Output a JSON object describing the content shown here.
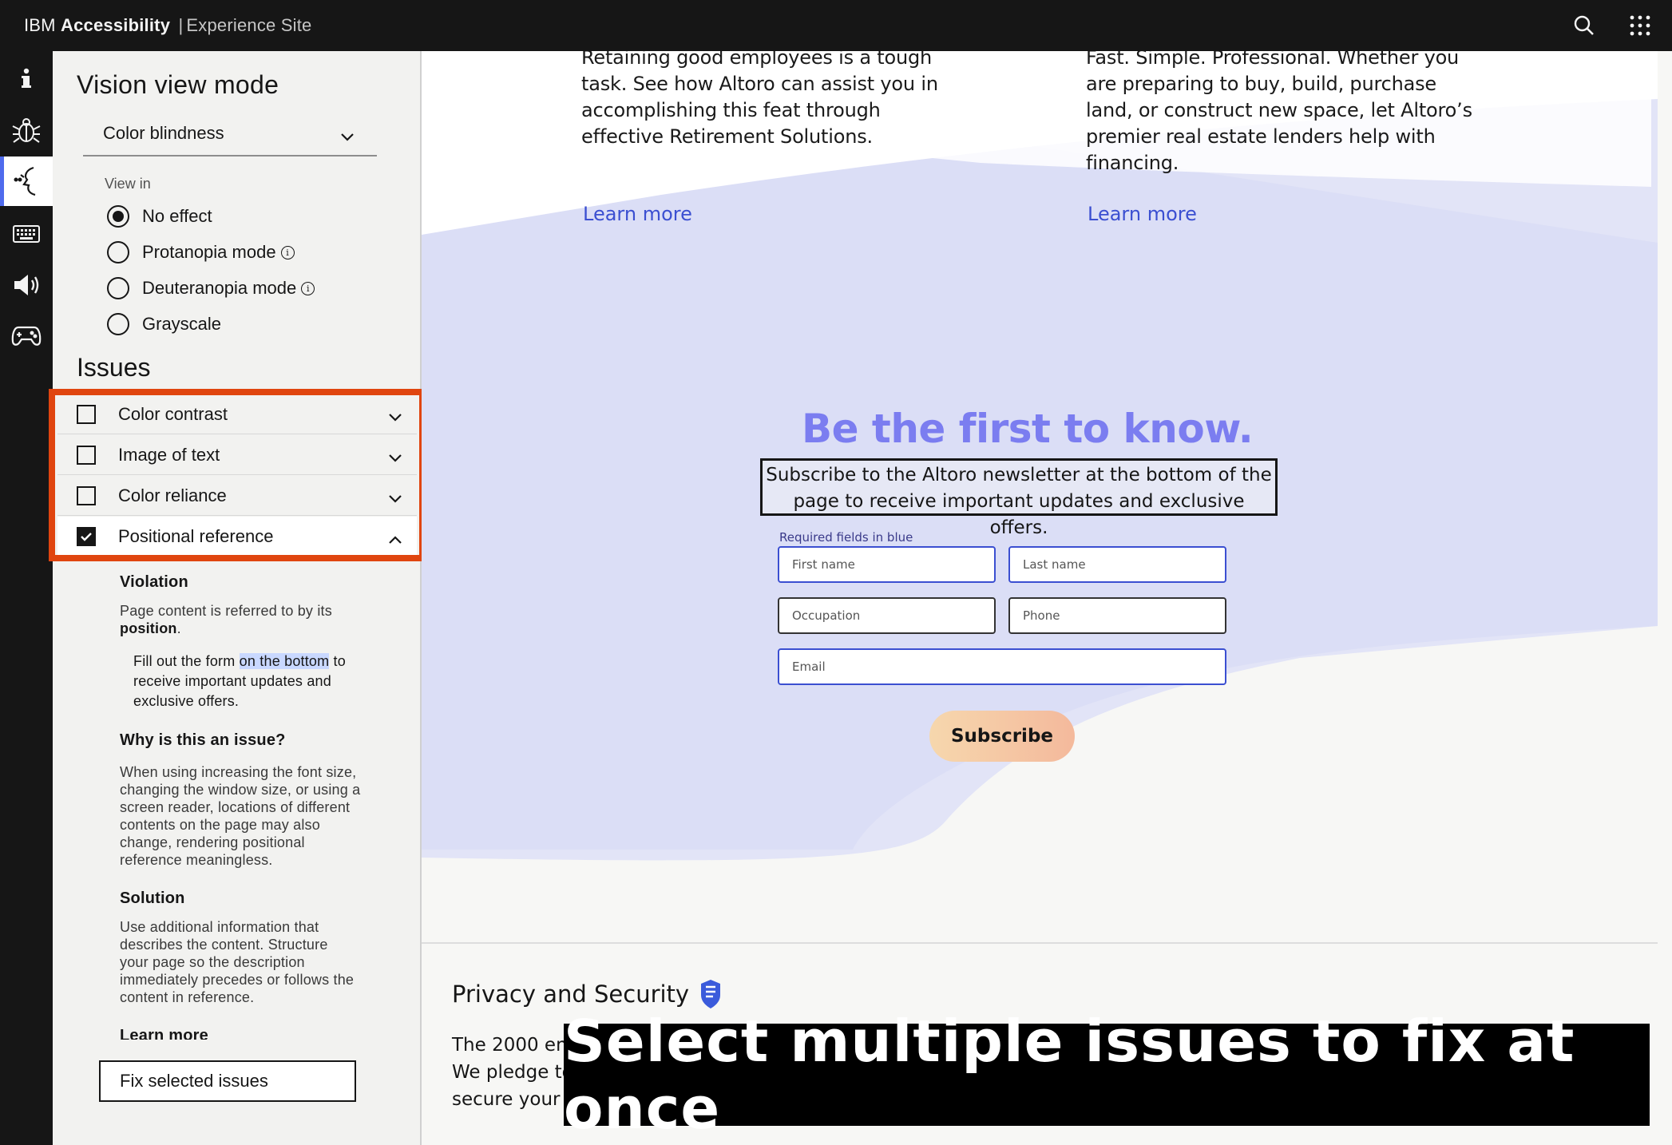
{
  "topbar": {
    "brand_ibm": "IBM",
    "brand_name": "Accessibility",
    "separator": "|",
    "brand_site": "Experience Site",
    "search_icon": "search-icon",
    "apps_icon": "app-switcher-icon"
  },
  "rail": {
    "items": [
      {
        "name": "info-icon"
      },
      {
        "name": "bug-icon"
      },
      {
        "name": "vision-icon",
        "active": true
      },
      {
        "name": "keyboard-icon"
      },
      {
        "name": "audio-icon"
      },
      {
        "name": "gamepad-icon"
      }
    ],
    "accent_color": "#4f6bed"
  },
  "panel": {
    "title": "Vision view mode",
    "dropdown_value": "Color blindness",
    "view_in_label": "View in",
    "radios": [
      {
        "label": "No effect",
        "selected": true,
        "info": false
      },
      {
        "label": "Protanopia mode",
        "selected": false,
        "info": true
      },
      {
        "label": "Deuteranopia mode",
        "selected": false,
        "info": true
      },
      {
        "label": "Grayscale",
        "selected": false,
        "info": false
      }
    ],
    "issues_title": "Issues",
    "issues": [
      {
        "label": "Color contrast",
        "checked": false,
        "open": false
      },
      {
        "label": "Image of text",
        "checked": false,
        "open": false
      },
      {
        "label": "Color reliance",
        "checked": false,
        "open": false
      },
      {
        "label": "Positional reference",
        "checked": true,
        "open": true
      }
    ],
    "highlight_color": "#e0450f",
    "detail": {
      "violation_heading": "Violation",
      "violation_text_1": "Page content is referred to by its",
      "violation_text_2": "position",
      "violation_text_3": ".",
      "example_1": "Fill out the form ",
      "example_highlight": "on the bottom",
      "example_2": " to",
      "example_3": "receive important updates and",
      "example_4": "exclusive offers.",
      "why_heading": "Why is this an issue?",
      "why_lines": [
        "When using increasing the font size,",
        "changing the window size, or using a",
        "screen reader, locations of different",
        "contents on the page may also",
        "change, rendering positional",
        "reference meaningless."
      ],
      "solution_heading": "Solution",
      "solution_lines": [
        "Use additional information that",
        "describes the content. Structure",
        "your page so the description",
        "immediately precedes or follows the",
        "content in reference."
      ],
      "learn_more": "Learn more"
    },
    "fix_button": "Fix selected issues"
  },
  "site": {
    "card_left_lines": [
      "Retaining good employees is a tough",
      "task. See how Altoro can assist you in",
      "accomplishing this feat through",
      "effective Retirement Solutions."
    ],
    "card_right_lines": [
      "Fast. Simple. Professional. Whether you",
      "are preparing to buy, build, purchase",
      "land, or construct new space, let Altoro’s",
      "premier real estate lenders help with",
      "financing."
    ],
    "learn_more_left": "Learn more",
    "learn_more_right": "Learn more",
    "hero": "Be the first to know.",
    "subscribe_line_1": "Subscribe to the Altoro newsletter at the bottom of the",
    "subscribe_line_2": "page to receive important updates and exclusive offers.",
    "required_note": "Required fields in blue",
    "fields": {
      "first_name": "First name",
      "last_name": "Last name",
      "occupation": "Occupation",
      "phone": "Phone",
      "email": "Email"
    },
    "subscribe_button": "Subscribe",
    "privacy_title": "Privacy and Security",
    "privacy_icon": "shield-icon",
    "privacy_lines": [
      "The 2000 em",
      "We pledge to",
      "secure your i"
    ],
    "brand_color": "#3b4fd1",
    "hero_color": "#7b7df0"
  },
  "caption": "Select multiple issues to fix at once"
}
